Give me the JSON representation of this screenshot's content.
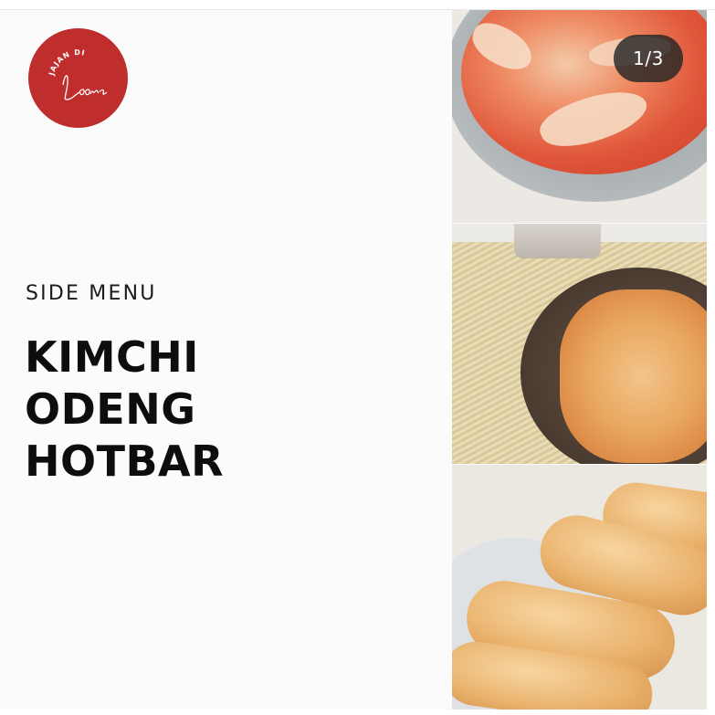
{
  "post": {
    "logo": {
      "top_text": "JAJAN DI",
      "script_text": "Loona",
      "color": "#bf2d2c"
    },
    "subtitle": "SIDE MENU",
    "title_lines": [
      "KIMCHI",
      "ODENG",
      "HOTBAR"
    ],
    "photos": [
      {
        "subject": "kimchi"
      },
      {
        "subject": "odeng"
      },
      {
        "subject": "hotbar"
      }
    ]
  },
  "carousel": {
    "counter": "1/3"
  }
}
